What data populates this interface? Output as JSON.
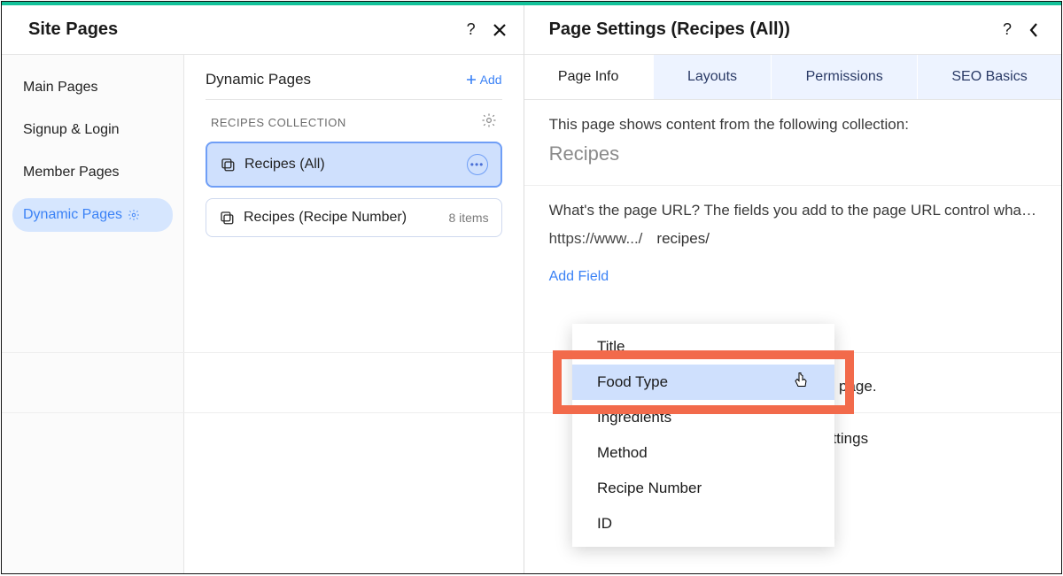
{
  "left": {
    "title": "Site Pages",
    "sidebar": [
      {
        "label": "Main Pages"
      },
      {
        "label": "Signup & Login"
      },
      {
        "label": "Member Pages"
      },
      {
        "label": "Dynamic Pages"
      }
    ],
    "dynamic": {
      "heading": "Dynamic Pages",
      "add": "Add",
      "collection_label": "RECIPES COLLECTION",
      "pages": [
        {
          "name": "Recipes (All)"
        },
        {
          "name": "Recipes (Recipe Number)",
          "meta": "8 items"
        }
      ]
    }
  },
  "right": {
    "title": "Page Settings (Recipes (All))",
    "tabs": [
      "Page Info",
      "Layouts",
      "Permissions",
      "SEO Basics"
    ],
    "info_line": "This page shows content from the following collection:",
    "collection": "Recipes",
    "url_prompt": "What's the page URL? The fields you add to the page URL control wha…",
    "url_prefix": "https://www.../",
    "url_path": "recipes/",
    "add_field": "Add Field",
    "bg_text_page": "is page.",
    "bg_text_settings": "ettings"
  },
  "dropdown": {
    "items": [
      "Title",
      "Food Type",
      "Ingredients",
      "Method",
      "Recipe Number",
      "ID"
    ]
  }
}
